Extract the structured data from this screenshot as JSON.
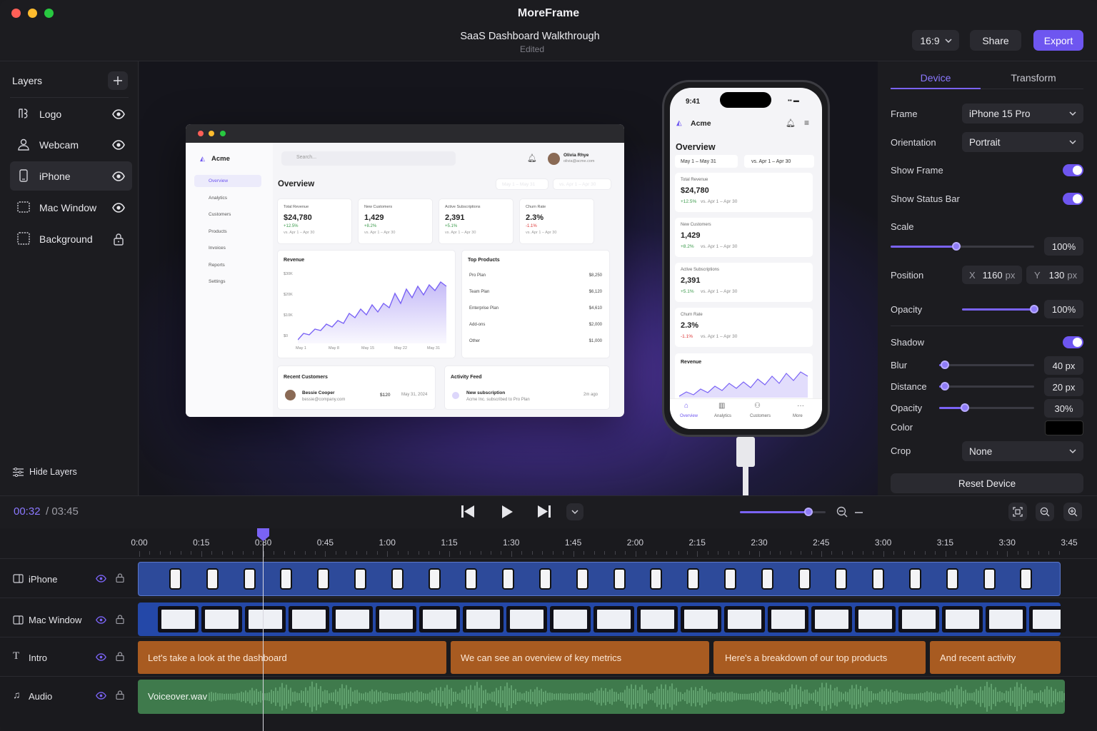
{
  "app": {
    "name": "MoreFrame",
    "project_title": "SaaS Dashboard Walkthrough",
    "project_status": "Edited"
  },
  "toolbar": {
    "aspect_ratio": "16:9",
    "share_label": "Share",
    "export_label": "Export"
  },
  "layers": {
    "title": "Layers",
    "items": [
      {
        "label": "Logo",
        "icon": "logo-icon",
        "state": "eye-icon"
      },
      {
        "label": "Webcam",
        "icon": "person-icon",
        "state": "eye-icon"
      },
      {
        "label": "iPhone",
        "icon": "phone-icon",
        "state": "eye-icon"
      },
      {
        "label": "Mac Window",
        "icon": "window-icon",
        "state": "eye-icon"
      },
      {
        "label": "Background",
        "icon": "background-icon",
        "state": "lock-icon"
      }
    ],
    "hide_label": "Hide Layers"
  },
  "mac_window": {
    "brand": "Acme",
    "search_placeholder": "Search...",
    "user_name": "Olivia Rhye",
    "user_email": "olivia@acme.com",
    "nav": [
      "Overview",
      "Analytics",
      "Customers",
      "Products",
      "Invoices",
      "Reports",
      "Settings"
    ],
    "heading": "Overview",
    "range1": "May 1 – May 31",
    "range2": "vs. Apr 1 – Apr 30",
    "stats": [
      {
        "label": "Total Revenue",
        "value": "$24,780",
        "delta": "+12.5%",
        "compare": "vs. Apr 1 – Apr 30"
      },
      {
        "label": "New Customers",
        "value": "1,429",
        "delta": "+8.2%",
        "compare": "vs. Apr 1 – Apr 30"
      },
      {
        "label": "Active Subscriptions",
        "value": "2,391",
        "delta": "+5.1%",
        "compare": "vs. Apr 1 – Apr 30"
      },
      {
        "label": "Churn Rate",
        "value": "2.3%",
        "delta": "-1.1%",
        "compare": "vs. Apr 1 – Apr 30"
      }
    ],
    "revenue": {
      "title": "Revenue",
      "yticks": [
        "$30K",
        "$20K",
        "$10K",
        "$0"
      ],
      "xticks": [
        "May 1",
        "May 8",
        "May 15",
        "May 22",
        "May 31"
      ]
    },
    "top_products": {
      "title": "Top Products",
      "rows": [
        [
          "Pro Plan",
          "$8,250"
        ],
        [
          "Team Plan",
          "$6,120"
        ],
        [
          "Enterprise Plan",
          "$4,610"
        ],
        [
          "Add-ons",
          "$2,000"
        ],
        [
          "Other",
          "$1,000"
        ]
      ]
    },
    "recent_customers": {
      "title": "Recent Customers",
      "name": "Bessie Cooper",
      "email": "bessie@company.com",
      "amount": "$120",
      "date": "May 31, 2024"
    },
    "activity": {
      "title": "Activity Feed",
      "event": "New subscription",
      "detail": "Acme Inc. subscribed to Pro Plan",
      "time": "2m ago"
    }
  },
  "phone_screen": {
    "time": "9:41",
    "brand": "Acme",
    "heading": "Overview",
    "range1": "May 1 – May 31",
    "range2": "vs. Apr 1 – Apr 30",
    "stats": [
      {
        "label": "Total Revenue",
        "value": "$24,780",
        "delta": "+12.5%",
        "compare": "vs. Apr 1 – Apr 30"
      },
      {
        "label": "New Customers",
        "value": "1,429",
        "delta": "+8.2%",
        "compare": "vs. Apr 1 – Apr 30"
      },
      {
        "label": "Active Subscriptions",
        "value": "2,391",
        "delta": "+5.1%",
        "compare": "vs. Apr 1 – Apr 30"
      },
      {
        "label": "Churn Rate",
        "value": "2.3%",
        "delta": "-1.1%",
        "compare": "vs. Apr 1 – Apr 30"
      }
    ],
    "revenue_title": "Revenue",
    "tabs": [
      "Overview",
      "Analytics",
      "Customers",
      "More"
    ]
  },
  "inspector": {
    "tabs": [
      "Device",
      "Transform"
    ],
    "frame_label": "Frame",
    "frame_value": "iPhone 15 Pro",
    "orientation_label": "Orientation",
    "orientation_value": "Portrait",
    "show_frame_label": "Show Frame",
    "show_frame": true,
    "show_status_label": "Show Status Bar",
    "show_status": true,
    "scale_label": "Scale",
    "scale_value": "100%",
    "scale_level": 0.46,
    "position_label": "Position",
    "x_label": "X",
    "x_value": "1160",
    "y_label": "Y",
    "y_value": "130",
    "unit": "px",
    "opacity_label": "Opacity",
    "opacity_value": "100%",
    "opacity_level": 1.0,
    "shadow_label": "Shadow",
    "shadow": true,
    "blur_label": "Blur",
    "blur_value": "40 px",
    "blur_level": 0.06,
    "distance_label": "Distance",
    "distance_value": "20 px",
    "distance_level": 0.06,
    "shadow_opacity_label": "Opacity",
    "shadow_opacity_value": "30%",
    "shadow_opacity_level": 0.27,
    "color_label": "Color",
    "color_value": "#000000",
    "crop_label": "Crop",
    "crop_value": "None",
    "reset_label": "Reset Device"
  },
  "transport": {
    "current": "00:32",
    "separator": "/ 03:45",
    "zoom_level": 0.8
  },
  "timeline": {
    "ticks": [
      "0:00",
      "0:15",
      "0:30",
      "0:45",
      "1:00",
      "1:15",
      "1:30",
      "1:45",
      "2:00",
      "2:15",
      "2:30",
      "2:45",
      "3:00",
      "3:15",
      "3:30",
      "3:45"
    ],
    "tracks": [
      {
        "name": "iPhone",
        "icon": "device-icon"
      },
      {
        "name": "Mac Window",
        "icon": "device-icon"
      },
      {
        "name": "Intro",
        "icon": "text-icon"
      },
      {
        "name": "Audio",
        "icon": "music-icon"
      }
    ],
    "captions": [
      "Let's take a look at the dashboard",
      "We can see an overview of key metrics",
      "Here's a breakdown of our top products",
      "And recent activity"
    ],
    "audio_clip": "Voiceover.wav",
    "colors": {
      "accent": "#6e56f0",
      "caption": "#a85b21",
      "audio": "#3f7a4c",
      "video": "#2d4a9a"
    }
  }
}
